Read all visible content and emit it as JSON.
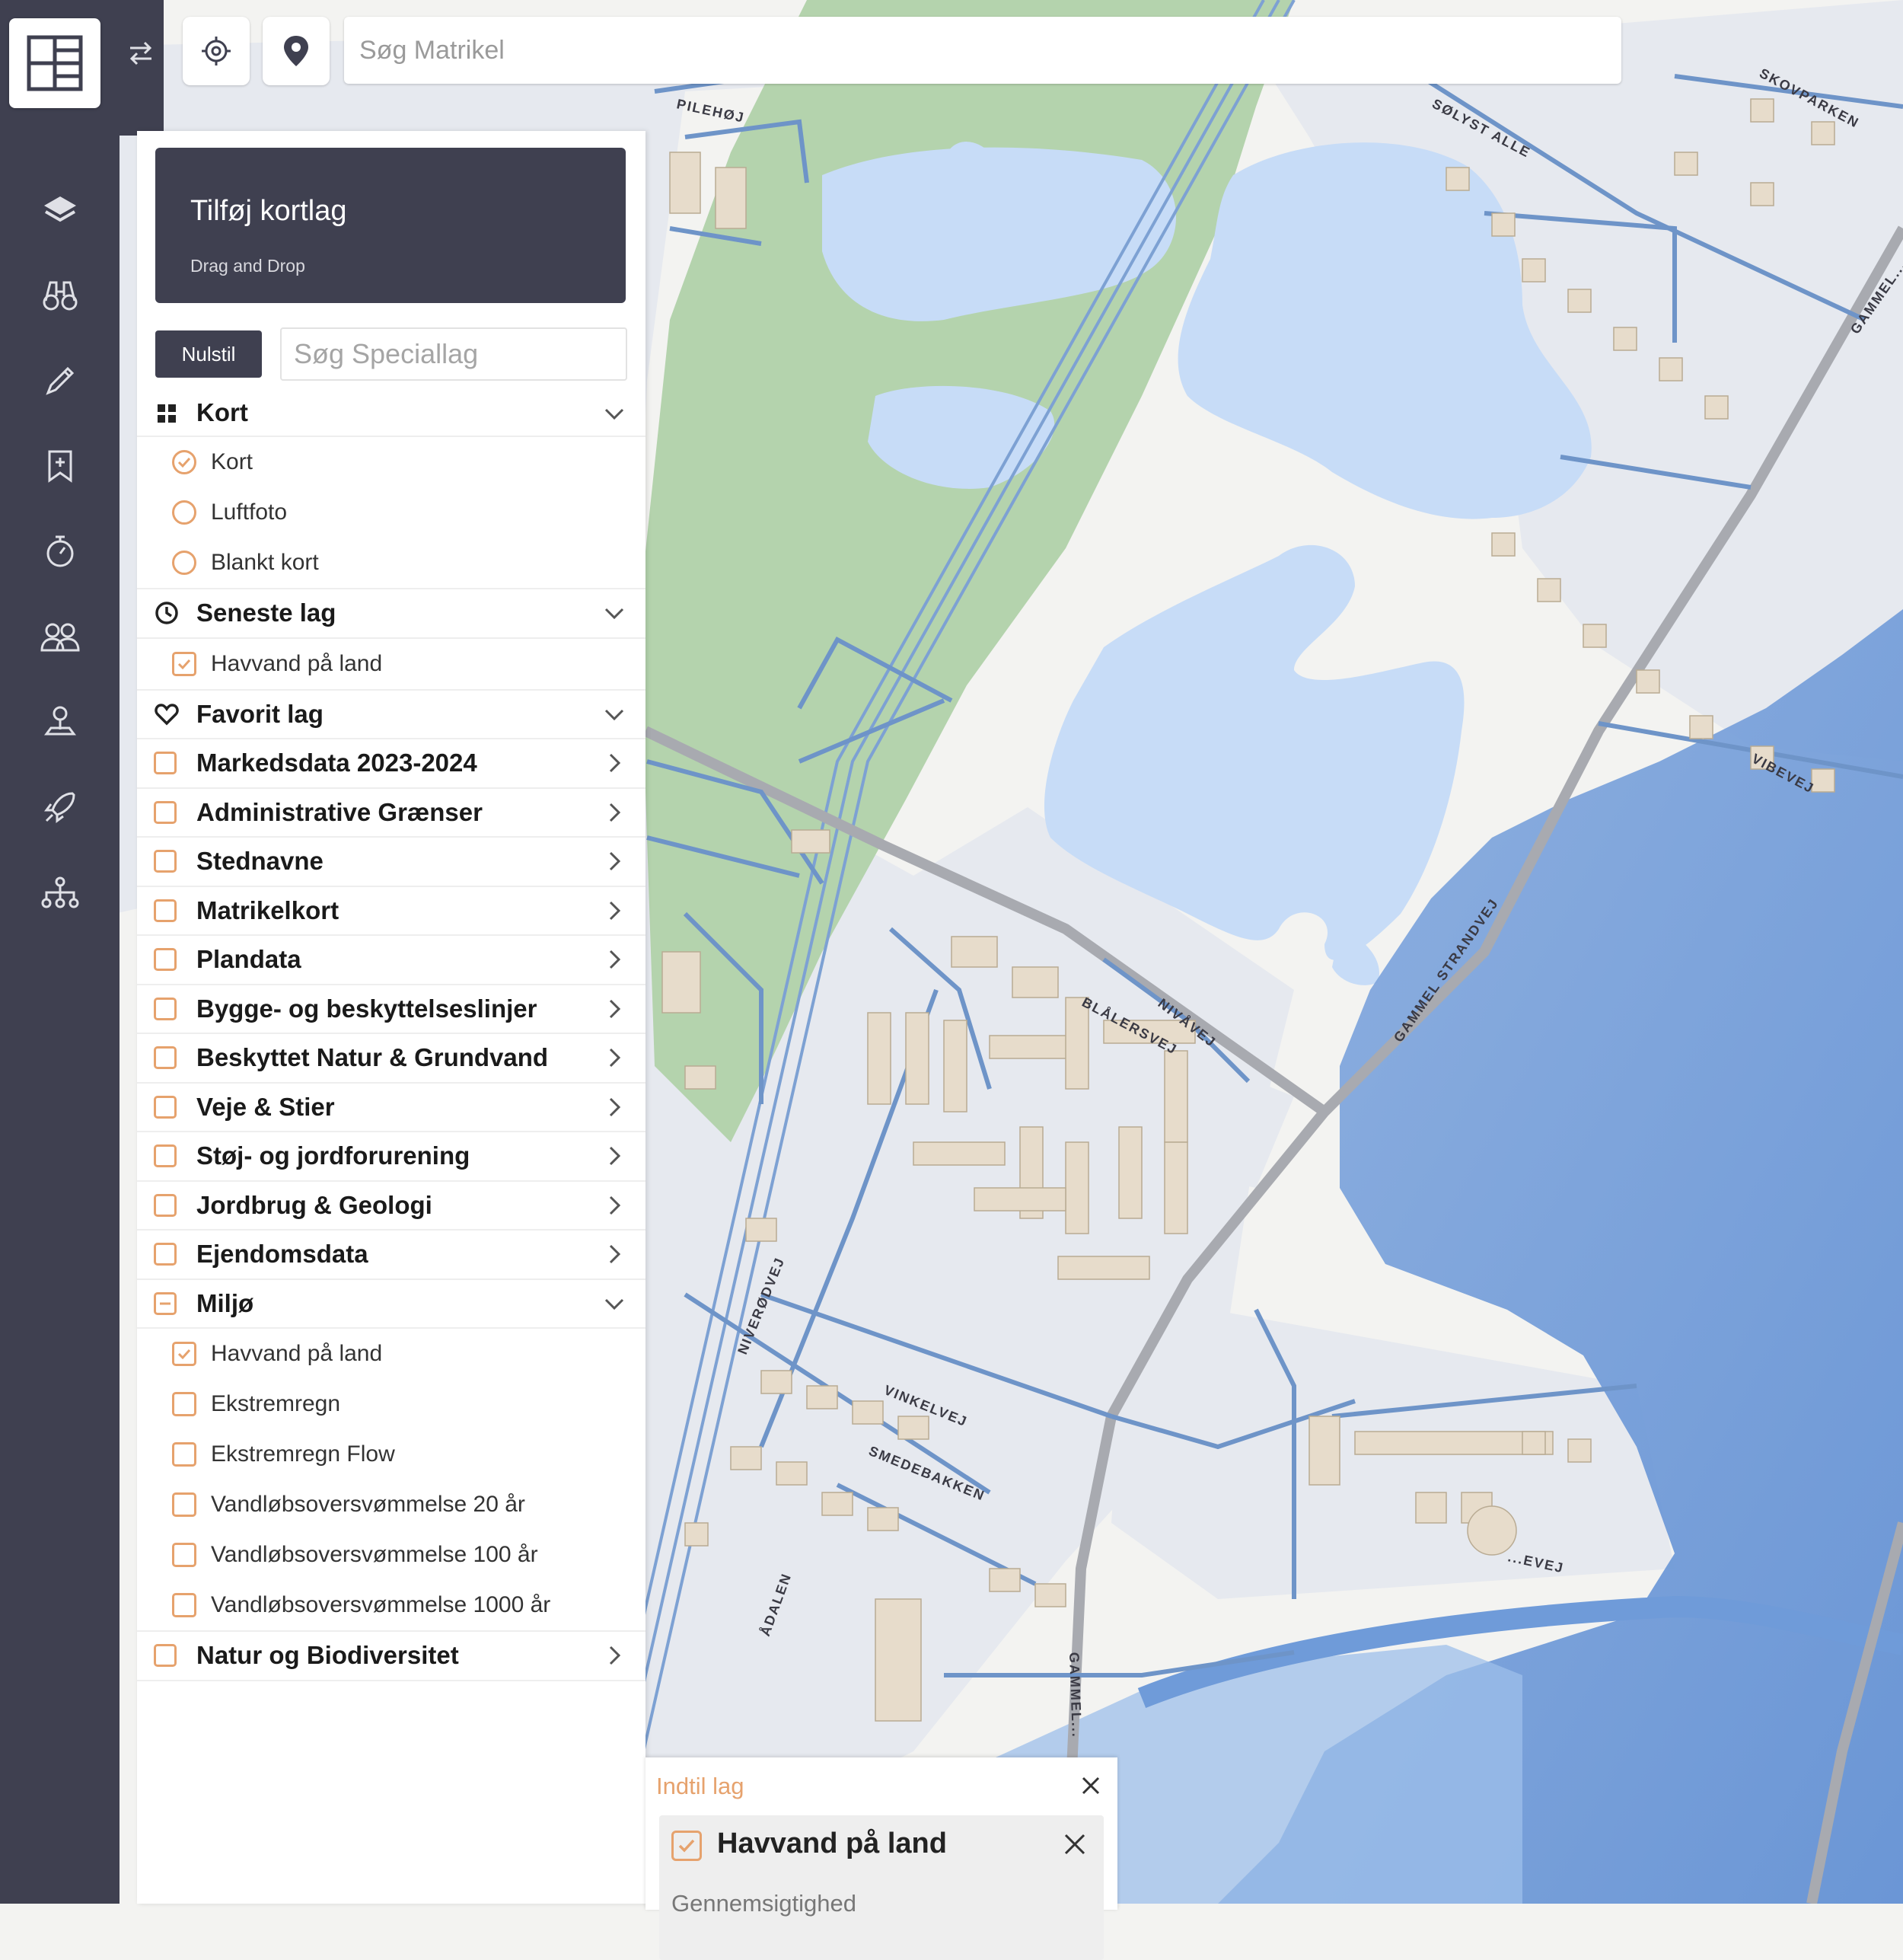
{
  "app": {
    "logo_name": "logo"
  },
  "search": {
    "placeholder": "Søg Matrikel"
  },
  "panel": {
    "dropzone_title": "Tilføj kortlag",
    "dropzone_subtitle": "Drag and Drop",
    "reset_label": "Nulstil",
    "special_search_placeholder": "Søg Speciallag"
  },
  "sections": {
    "kort": {
      "label": "Kort",
      "options": [
        "Kort",
        "Luftfoto",
        "Blankt kort"
      ],
      "selected": "Kort"
    },
    "seneste": {
      "label": "Seneste lag",
      "items": [
        "Havvand på land"
      ]
    },
    "favorit": {
      "label": "Favorit lag"
    },
    "groups": [
      "Markedsdata 2023-2024",
      "Administrative Grænser",
      "Stednavne",
      "Matrikelkort",
      "Plandata",
      "Bygge- og beskyttelseslinjer",
      "Beskyttet Natur & Grundvand",
      "Veje & Stier",
      "Støj- og jordforurening",
      "Jordbrug & Geologi",
      "Ejendomsdata"
    ],
    "miljo": {
      "label": "Miljø",
      "items": [
        {
          "label": "Havvand på land",
          "checked": true
        },
        {
          "label": "Ekstremregn",
          "checked": false
        },
        {
          "label": "Ekstremregn Flow",
          "checked": false
        },
        {
          "label": "Vandløbsoversvømmelse 20 år",
          "checked": false
        },
        {
          "label": "Vandløbsoversvømmelse 100 år",
          "checked": false
        },
        {
          "label": "Vandløbsoversvømmelse 1000 år",
          "checked": false
        }
      ]
    },
    "natur": {
      "label": "Natur og Biodiversitet"
    }
  },
  "popup": {
    "title": "Indtil lag",
    "layer": "Havvand på land",
    "opacity_label": "Gennemsigtighed"
  },
  "map_labels": {
    "pilehoj": "PILEHØJ",
    "solyst": "SØLYST ALLE",
    "skovparken": "SKOVPARKEN",
    "gammel_strandvej": "GAMMEL STRANDVEJ",
    "vibevej": "VIBEVEJ",
    "blaalersvej": "BLÅLERSVEJ",
    "nivavej": "NIVÅVEJ",
    "niverodvej": "NIVERØDVEJ",
    "vinkelvej": "VINKELVEJ",
    "smedebakken": "SMEDEBAKKEN",
    "aadalen": "ÅDALEN",
    "gammel_short": "GAMMEL...",
    "gammel_top": "GAMMEL...",
    "havevej": "...EVEJ"
  },
  "colors": {
    "rail": "#3f4050",
    "accent": "#e6a26d",
    "park": "#b4d3ad",
    "water_light": "#c7dcf7",
    "flood": "#6f9bd9",
    "road": "#6e94c8",
    "building": "#e7dccb"
  }
}
